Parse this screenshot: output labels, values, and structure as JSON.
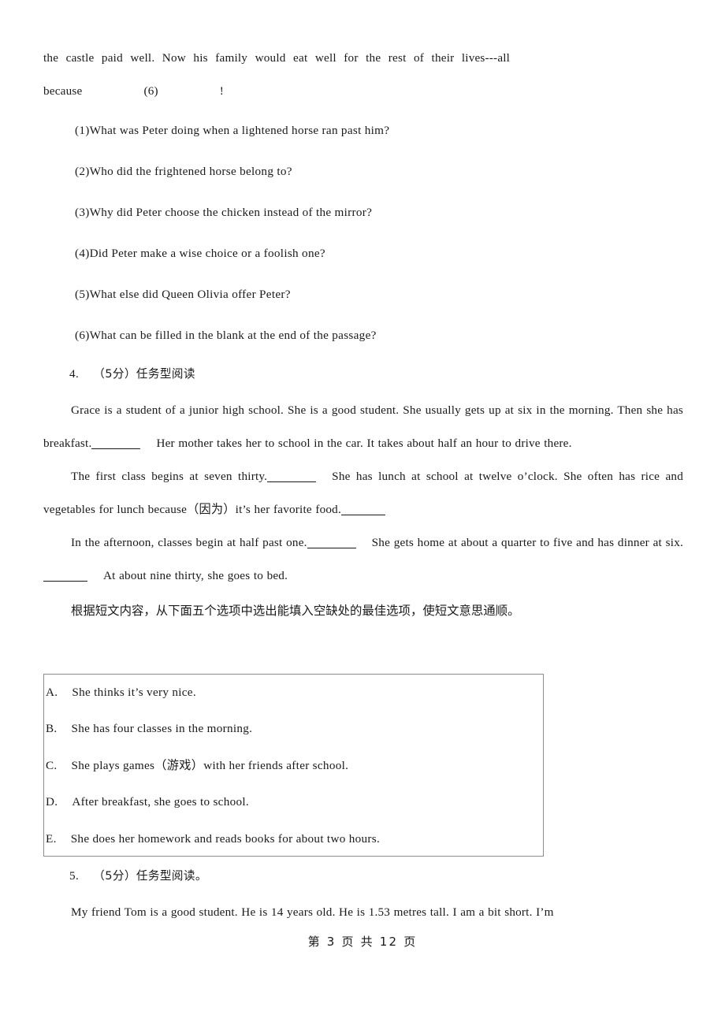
{
  "document": {
    "footer": "第 3 页 共 12 页"
  },
  "top_passage": {
    "line1": "the castle paid well. Now his family would eat well for the rest of their lives---all",
    "line2_lead": "because",
    "line2_marker": "(6)",
    "line2_end": "!"
  },
  "questions": [
    {
      "label": "(1)",
      "text": "What was Peter doing when a lightened horse ran past him?"
    },
    {
      "label": "(2)",
      "text": "Who did the frightened horse belong to?"
    },
    {
      "label": "(3)",
      "text": "Why did Peter choose the chicken instead of the mirror?"
    },
    {
      "label": "(4)",
      "text": "Did Peter make a wise choice or a foolish one?"
    },
    {
      "label": "(5)",
      "text": "What else did Queen Olivia offer Peter?"
    },
    {
      "label": "(6)",
      "text": "What can be filled in the blank at the end of the passage?"
    }
  ],
  "section4": {
    "heading_number": "4.",
    "heading_score": "（5分）",
    "heading_title": "任务型阅读",
    "paragraph1": {
      "part1": "Grace is a student of a junior high school. She is a good student. She usually gets up at six in the morning. Then she has breakfast.",
      "part2": "Her mother takes her to school in the car. It takes about half an hour to drive there."
    },
    "paragraph2": {
      "part1": "The first class begins at seven thirty.",
      "part2": "She has lunch at school at twelve o’clock. She often has rice and vegetables for lunch because（因为）it’s her favorite food.",
      "part3": ""
    },
    "paragraph3": {
      "part1": "In the afternoon, classes begin at half past one.",
      "part2": "She gets home at about a quarter to five and has dinner at six.",
      "part3": "At about nine thirty, she goes to bed."
    },
    "instruction": "根据短文内容，从下面五个选项中选出能填入空缺处的最佳选项，使短文意思通顺。",
    "options": [
      {
        "letter": "A.",
        "text": "She thinks it’s very nice."
      },
      {
        "letter": "B.",
        "text": "She has four classes in the morning."
      },
      {
        "letter": "C.",
        "text": "She plays games（游戏）with her friends after school."
      },
      {
        "letter": "D.",
        "text": "After breakfast, she goes to school."
      },
      {
        "letter": "E.",
        "text": "She does her homework and reads books for about two hours."
      }
    ]
  },
  "section5": {
    "heading_number": "5.",
    "heading_score": "（5分）",
    "heading_title": "任务型阅读。",
    "paragraph1": "My friend Tom is a good student. He is 14 years old. He is 1.53 metres tall. I am a bit short. I’m"
  }
}
